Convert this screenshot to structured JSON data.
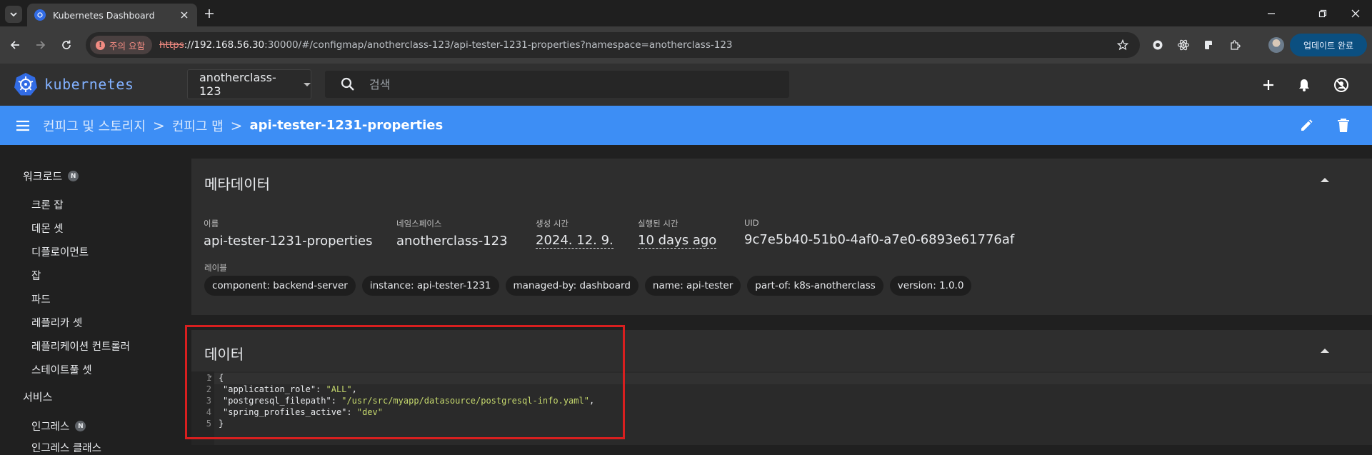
{
  "browser": {
    "tab_title": "Kubernetes Dashboard",
    "security_chip": "주의 요함",
    "url_scheme": "https",
    "url_host": "://192.168.56.30",
    "url_rest": ":30000/#/configmap/anotherclass-123/api-tester-1231-properties?namespace=anotherclass-123",
    "update_button": "업데이트 완료"
  },
  "header": {
    "brand": "kubernetes",
    "namespace": "anotherclass-123",
    "search_placeholder": "검색"
  },
  "toolbar": {
    "breadcrumbs": [
      "컨피그 및 스토리지",
      "컨피그 맵",
      "api-tester-1231-properties"
    ],
    "breadcrumb_separator": ">"
  },
  "sidebar": {
    "workloads": {
      "label": "워크로드",
      "badge": "N"
    },
    "workload_items": [
      "크론 잡",
      "데몬 셋",
      "디플로이먼트",
      "잡",
      "파드",
      "레플리카 셋",
      "레플리케이션 컨트롤러",
      "스테이트풀 셋"
    ],
    "services": {
      "label": "서비스"
    },
    "service_items": [
      {
        "label": "인그레스",
        "badge": "N"
      },
      {
        "label": "인그레스 클래스"
      }
    ]
  },
  "metadata": {
    "title": "메타데이터",
    "fields": [
      {
        "label": "이름",
        "value": "api-tester-1231-properties"
      },
      {
        "label": "네임스페이스",
        "value": "anotherclass-123"
      },
      {
        "label": "생성 시간",
        "value": "2024. 12. 9."
      },
      {
        "label": "실행된 시간",
        "value": "10 days ago"
      },
      {
        "label": "UID",
        "value": "9c7e5b40-51b0-4af0-a7e0-6893e61776af"
      }
    ],
    "labels_title": "레이블",
    "labels": [
      "component: backend-server",
      "instance: api-tester-1231",
      "managed-by: dashboard",
      "name: api-tester",
      "part-of: k8s-anotherclass",
      "version: 1.0.0"
    ]
  },
  "data_section": {
    "title": "데이터",
    "line_numbers": [
      "1",
      "2",
      "3",
      "4",
      "5"
    ],
    "open_brace": "{",
    "close_brace": "}",
    "entries": [
      {
        "key": "\"application_role\"",
        "value": "\"ALL\"",
        "trail": ","
      },
      {
        "key": "\"postgresql_filepath\"",
        "value": "\"/usr/src/myapp/datasource/postgresql-info.yaml\"",
        "trail": ","
      },
      {
        "key": "\"spring_profiles_active\"",
        "value": "\"dev\"",
        "trail": ""
      }
    ]
  },
  "colors": {
    "accent_blue": "#3d8ef5",
    "highlight_red": "#d81f1f",
    "code_string": "#c5d86d"
  },
  "icons": [
    "kubernetes-logo-icon",
    "search-icon",
    "plus-icon",
    "bell-icon",
    "incognito-icon",
    "menu-icon",
    "edit-pencil-icon",
    "delete-trash-icon"
  ]
}
